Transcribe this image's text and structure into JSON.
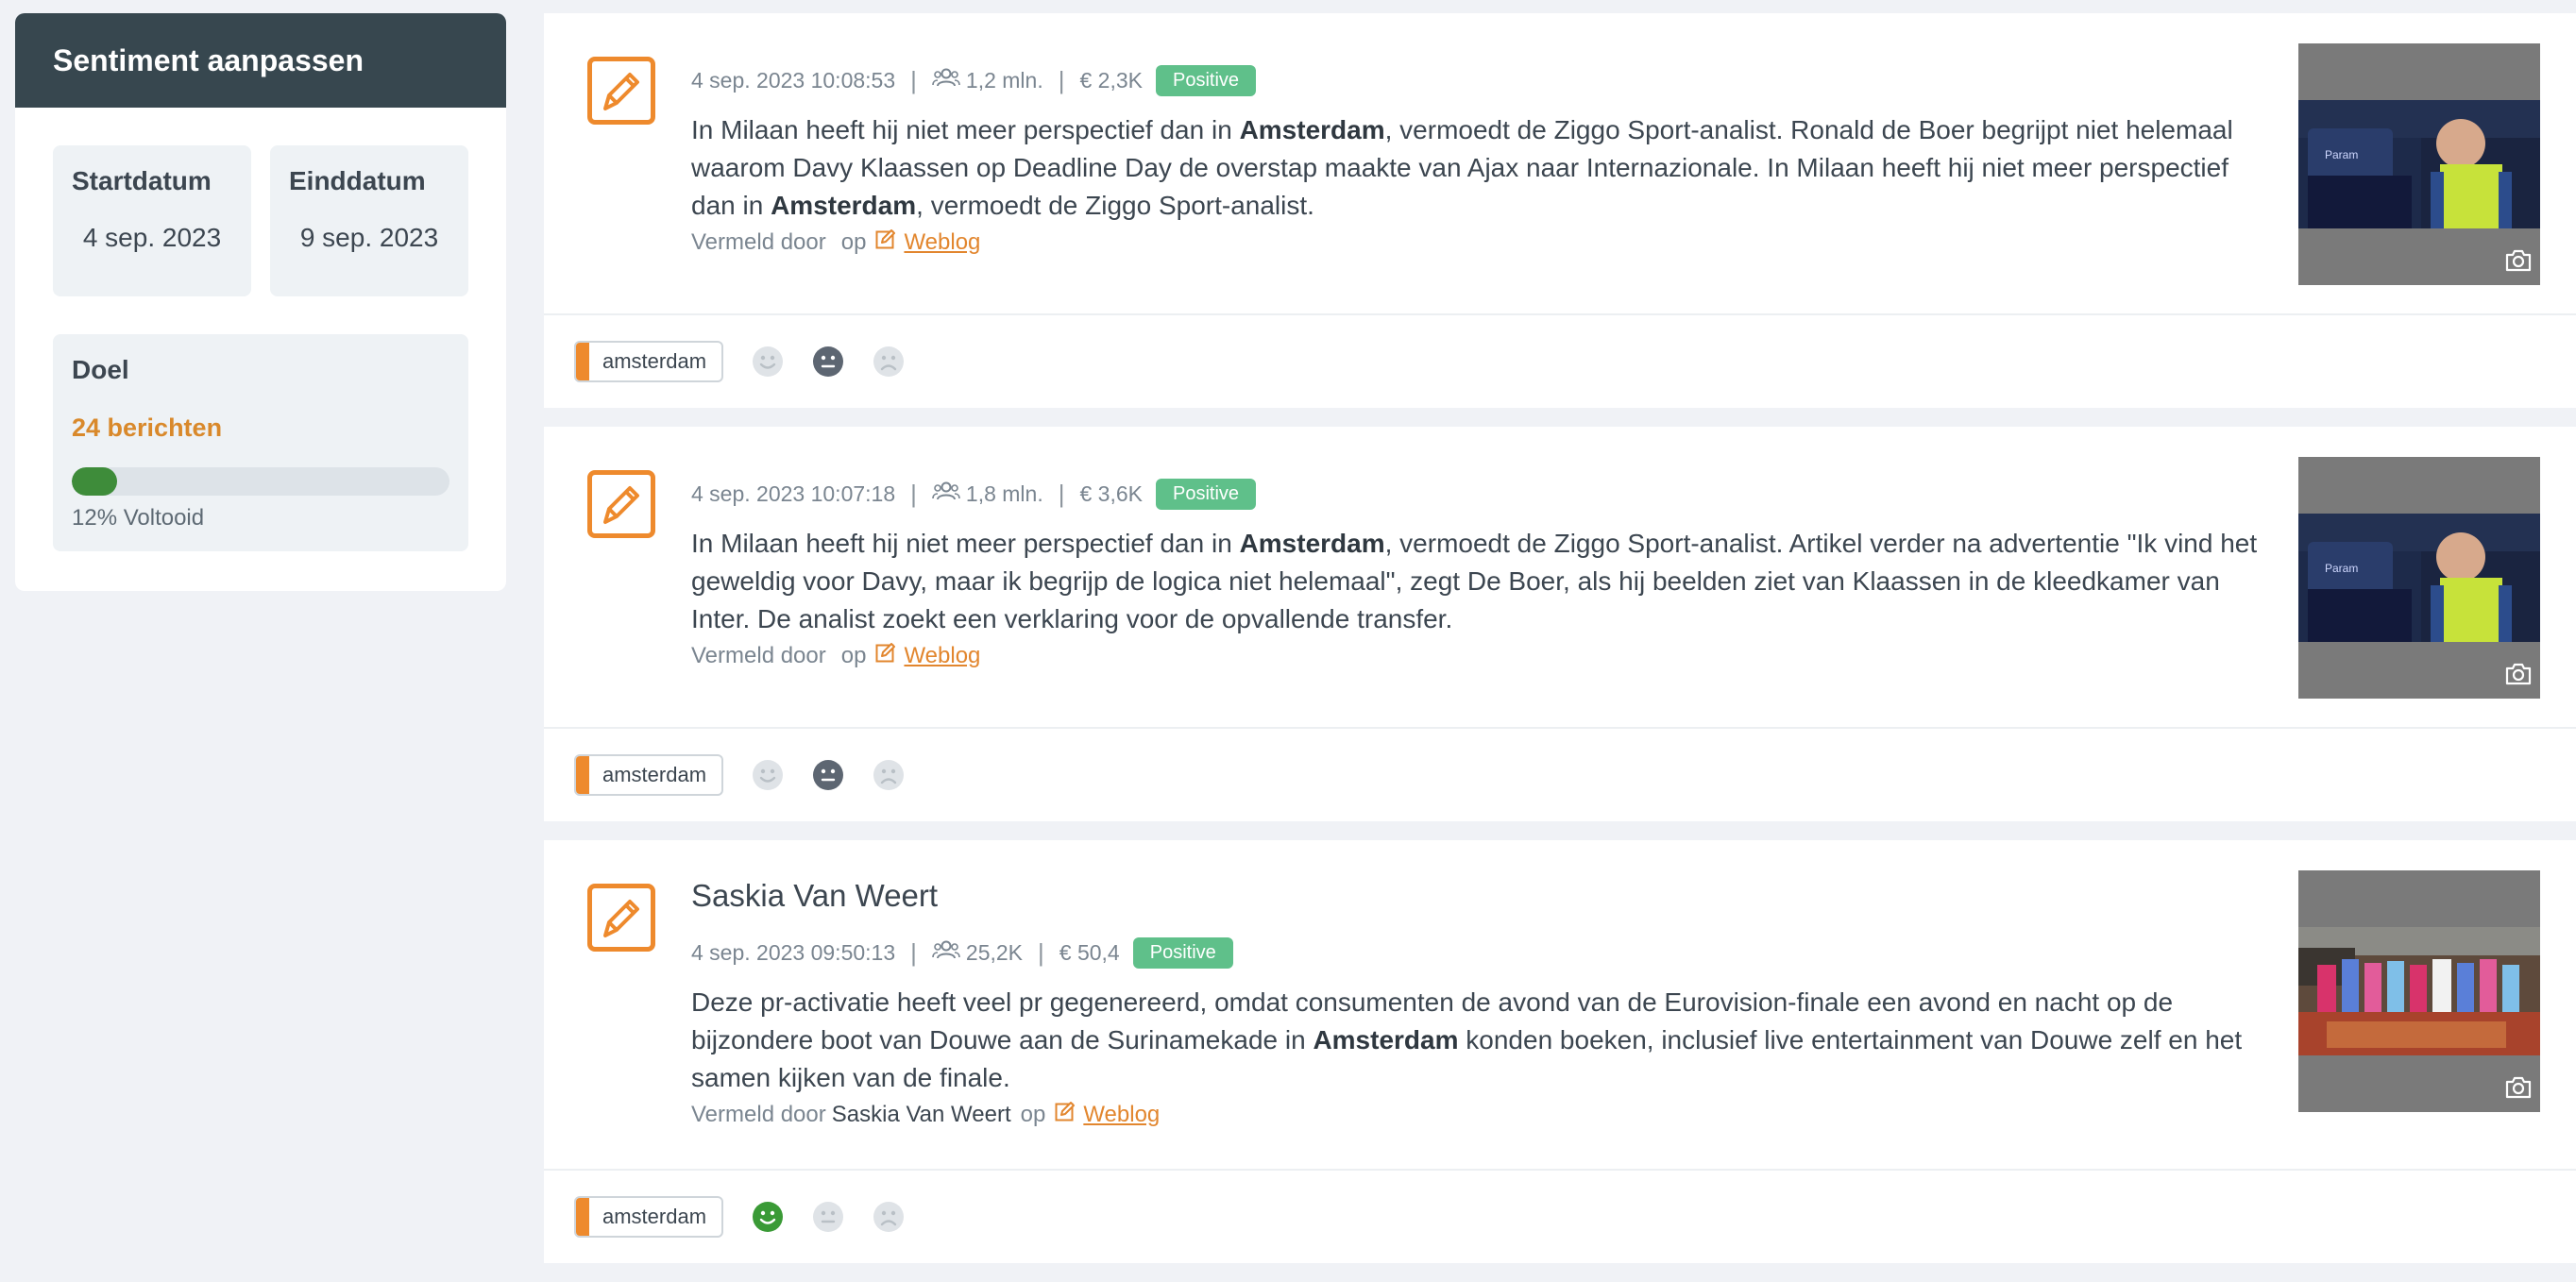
{
  "sidebar": {
    "title": "Sentiment aanpassen",
    "start_label": "Startdatum",
    "start_value": "4 sep. 2023",
    "end_label": "Einddatum",
    "end_value": "9 sep. 2023",
    "goal_label": "Doel",
    "goal_count": "24 berichten",
    "progress_fraction": 0.12,
    "progress_text": "12% Voltooid"
  },
  "colors": {
    "accent": "#ee8a2d",
    "header": "#37474f",
    "positive_badge": "#5fc08a",
    "progress": "#3e8c3a"
  },
  "posts": [
    {
      "author": "",
      "datetime": "4 sep. 2023 10:08:53",
      "reach": "1,2 mln.",
      "value": "€ 2,3K",
      "sentiment_badge": "Positive",
      "text_parts": [
        "In Milaan heeft hij niet meer perspectief dan in ",
        "Amsterdam",
        ", vermoedt de Ziggo Sport-analist. Ronald de Boer begrijpt niet helemaal waarom Davy Klaassen op Deadline Day de overstap maakte van Ajax naar Internazionale. In Milaan heeft hij niet meer perspectief dan in ",
        "Amsterdam",
        ", vermoedt de Ziggo Sport-analist."
      ],
      "mention_prefix": "Vermeld door",
      "mention_author": "",
      "mention_op": "op",
      "source": "Weblog",
      "tag": "amsterdam",
      "selected_sentiment": "neutral"
    },
    {
      "author": "",
      "datetime": "4 sep. 2023 10:07:18",
      "reach": "1,8 mln.",
      "value": "€ 3,6K",
      "sentiment_badge": "Positive",
      "text_parts": [
        "In Milaan heeft hij niet meer perspectief dan in ",
        "Amsterdam",
        ", vermoedt de Ziggo Sport-analist. Artikel verder na advertentie \"Ik vind het geweldig voor Davy, maar ik begrijp de logica niet helemaal\", zegt De Boer, als hij beelden ziet van Klaassen in de kleedkamer van Inter. De analist zoekt een verklaring voor de opvallende transfer.",
        "",
        ""
      ],
      "mention_prefix": "Vermeld door",
      "mention_author": "",
      "mention_op": "op",
      "source": "Weblog",
      "tag": "amsterdam",
      "selected_sentiment": "neutral"
    },
    {
      "author": "Saskia Van Weert",
      "datetime": "4 sep. 2023 09:50:13",
      "reach": "25,2K",
      "value": "€ 50,4",
      "sentiment_badge": "Positive",
      "text_parts": [
        "Deze pr-activatie heeft veel pr gegenereerd, omdat consumenten de avond van de Eurovision-finale een avond en nacht op de bijzondere boot van Douwe aan de Surinamekade in ",
        "Amsterdam",
        " konden boeken, inclusief live entertainment van Douwe zelf en het samen kijken van de finale.",
        "",
        ""
      ],
      "mention_prefix": "Vermeld door",
      "mention_author": "Saskia Van Weert",
      "mention_op": "op",
      "source": "Weblog",
      "tag": "amsterdam",
      "selected_sentiment": "positive"
    }
  ]
}
